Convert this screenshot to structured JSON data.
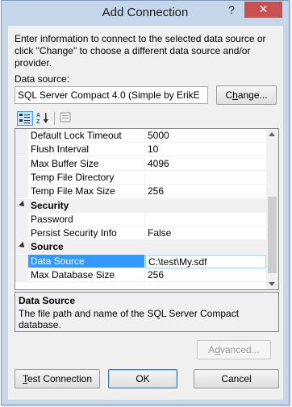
{
  "window": {
    "title": "Add Connection",
    "help_glyph": "?",
    "close_glyph": "✕"
  },
  "intro_text": "Enter information to connect to the selected data source or click \"Change\" to choose a different data source and/or provider.",
  "data_source": {
    "label": "Data source:",
    "value": "SQL Server Compact 4.0 (Simple by ErikE",
    "change_button": "Change..."
  },
  "toolbar": {
    "categorized_icon": "categorized-icon",
    "alphabetical_icon": "alphabetical-sort-icon",
    "property_pages_icon": "property-pages-icon"
  },
  "property_grid": {
    "rows": [
      {
        "kind": "prop",
        "name": "Default Lock Timeout",
        "value": "5000"
      },
      {
        "kind": "prop",
        "name": "Flush Interval",
        "value": "10"
      },
      {
        "kind": "prop",
        "name": "Max Buffer Size",
        "value": "4096"
      },
      {
        "kind": "prop",
        "name": "Temp File Directory",
        "value": ""
      },
      {
        "kind": "prop",
        "name": "Temp File Max Size",
        "value": "256"
      },
      {
        "kind": "category",
        "name": "Security"
      },
      {
        "kind": "prop",
        "name": "Password",
        "value": ""
      },
      {
        "kind": "prop",
        "name": "Persist Security Info",
        "value": "False"
      },
      {
        "kind": "category",
        "name": "Source"
      },
      {
        "kind": "prop",
        "name": "Data Source",
        "value": "C:\\test\\My.sdf",
        "selected": true
      },
      {
        "kind": "prop",
        "name": "Max Database Size",
        "value": "256"
      }
    ]
  },
  "description": {
    "title": "Data Source",
    "text": "The file path and name of the SQL Server Compact database."
  },
  "buttons": {
    "advanced": "Advanced...",
    "test_connection": "Test Connection",
    "ok": "OK",
    "cancel": "Cancel"
  },
  "colors": {
    "selection": "#3399ff",
    "window_frame": "#c6d7ec",
    "close_button": "#c75050"
  }
}
